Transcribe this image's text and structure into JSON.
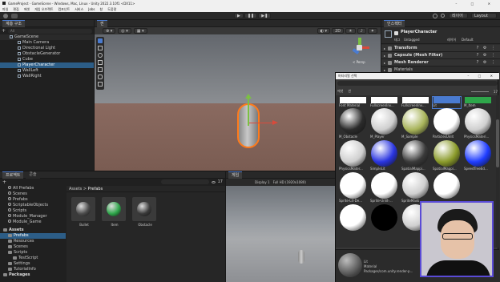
{
  "window": {
    "title": "GameProject - GameScene - Windows, Mac, Linux - Unity 2022.3.10f1 <DX11>"
  },
  "menu": [
    "파일",
    "편집",
    "에셋",
    "게임 오브젝트",
    "컴포넌트",
    "서비스",
    "Jobs",
    "창",
    "도움말"
  ],
  "toolbar": {
    "layers": "레이어",
    "layout": "Layout"
  },
  "hierarchy": {
    "tab": "계층 구조",
    "search": "All",
    "scene": "GameScene",
    "items": [
      "Main Camera",
      "Directional Light",
      "ObstacleGenerator",
      "Cube",
      "PlayerCharacter",
      "WallLeft",
      "WallRight"
    ]
  },
  "scene_view": {
    "tab": "씬",
    "mode_2d": "2D",
    "persp": "< Persp"
  },
  "project": {
    "tabs": [
      "프로젝트",
      "콘솔"
    ],
    "count": "17",
    "favorites": "All Prefabs",
    "favorites_items": [
      "Scenes",
      "Prefabs",
      "ScriptableObjects",
      "Scripts",
      "Module_Manager",
      "Module_Game"
    ],
    "assets_root": "Assets",
    "assets_items": [
      "Prefabs",
      "Resources",
      "Scenes",
      "Scripts",
      "TestScript",
      "Settings",
      "TutorialInfo"
    ],
    "packages": "Packages",
    "breadcrumb_a": "Assets",
    "breadcrumb_b": "Prefabs",
    "prefabs": [
      "Bullet",
      "Item",
      "Obstacle"
    ]
  },
  "game_view": {
    "tab": "게임",
    "display": "Display 1",
    "resolution": "Full HD (1920x1080)"
  },
  "inspector": {
    "tab": "인스펙터",
    "object_name": "PlayerCharacter",
    "tag_label": "태그",
    "tag_value": "Untagged",
    "layer_label": "레이어",
    "layer_value": "Default",
    "components": [
      "Transform",
      "Capsule (Mesh Filter)",
      "Mesh Renderer",
      "Materials"
    ]
  },
  "material_picker": {
    "title": "머티리얼 선택",
    "tabs": [
      "에셋",
      "씬"
    ],
    "count": "17",
    "row1_labels": [
      "Font Material",
      "FullscreenInv...",
      "FullscreenInv...",
      "Lit",
      "M_Item"
    ],
    "row2_labels": [
      "M_Obstacle",
      "M_Player",
      "M_Sample",
      "ParticlesUnlit",
      "PhysicsMateri..."
    ],
    "row3_labels": [
      "PhysicsMater...",
      "SimpleLit",
      "SpatialMappi...",
      "SpatialMappi...",
      "SpeedTreeEd..."
    ],
    "row4_labels": [
      "Sprite-Lit-De...",
      "Sprite-Unlit-...",
      "SpriteMask",
      ""
    ],
    "footer_name": "Lit",
    "footer_type": "Material",
    "footer_path": "Packages/com.unity.render-p..."
  },
  "colors": {
    "accent": "#4a7bd0",
    "selection": "#2c5d87"
  }
}
